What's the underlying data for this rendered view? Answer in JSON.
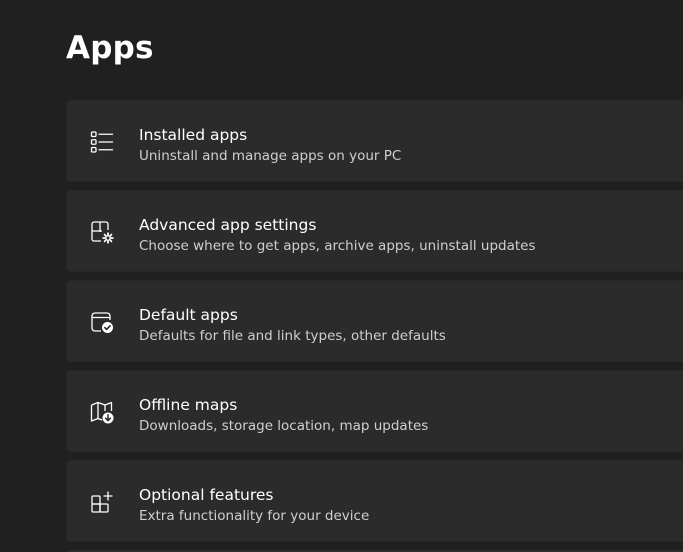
{
  "page": {
    "title": "Apps"
  },
  "items": [
    {
      "title": "Installed apps",
      "description": "Uninstall and manage apps on your PC",
      "icon": "list-icon"
    },
    {
      "title": "Advanced app settings",
      "description": "Choose where to get apps, archive apps, uninstall updates",
      "icon": "app-settings-gear-icon"
    },
    {
      "title": "Default apps",
      "description": "Defaults for file and link types, other defaults",
      "icon": "default-apps-check-icon"
    },
    {
      "title": "Offline maps",
      "description": "Downloads, storage location, map updates",
      "icon": "map-download-icon"
    },
    {
      "title": "Optional features",
      "description": "Extra functionality for your device",
      "icon": "add-grid-icon"
    }
  ],
  "colors": {
    "background": "#202020",
    "card": "#2b2b2b",
    "text_primary": "#ffffff",
    "text_secondary": "#cfcfcf"
  }
}
